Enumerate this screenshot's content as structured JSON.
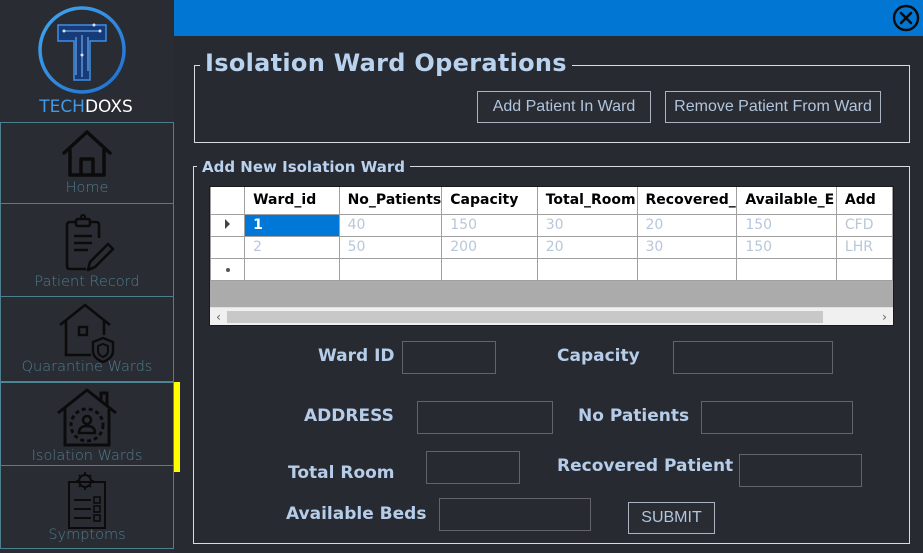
{
  "app": {
    "brand_part1": "TECH",
    "brand_part2": "DOXS",
    "close_icon": "circle-x-icon"
  },
  "sidebar": {
    "items": [
      {
        "label": "Home",
        "icon": "home-icon",
        "active": false
      },
      {
        "label": "Patient Record",
        "icon": "clipboard-pencil-icon",
        "active": false
      },
      {
        "label": "Quarantine Wards",
        "icon": "house-shield-icon",
        "active": false
      },
      {
        "label": "Isolation Wards",
        "icon": "house-person-icon",
        "active": true
      },
      {
        "label": "Symptoms",
        "icon": "virus-checklist-icon",
        "active": false
      }
    ],
    "active_indicator_color": "#ffff00"
  },
  "colors": {
    "topbar": "#0176d3",
    "background": "#282a32",
    "selection": "#0178d7",
    "label_text": "#b5cde9"
  },
  "operations": {
    "title": "Isolation Ward Operations",
    "add_patient_label": "Add Patient In Ward",
    "remove_patient_label": "Remove Patient From Ward"
  },
  "ward_form": {
    "title": "Add New Isolation Ward",
    "grid": {
      "columns": [
        "Ward_id",
        "No_Patients",
        "Capacity",
        "Total_Room",
        "Recovered_",
        "Available_E",
        "Add"
      ],
      "rows": [
        [
          "1",
          "40",
          "150",
          "30",
          "20",
          "150",
          "CFD"
        ],
        [
          "2",
          "50",
          "200",
          "20",
          "30",
          "150",
          "LHR"
        ]
      ],
      "selected_row": 0
    },
    "fields": {
      "ward_id": {
        "label": "Ward ID",
        "value": ""
      },
      "capacity": {
        "label": "Capacity",
        "value": ""
      },
      "address": {
        "label": "ADDRESS",
        "value": ""
      },
      "no_patients": {
        "label": "No Patients",
        "value": ""
      },
      "total_room": {
        "label": "Total Room",
        "value": ""
      },
      "recovered_patient": {
        "label": "Recovered Patient",
        "value": ""
      },
      "available_beds": {
        "label": "Available Beds",
        "value": ""
      }
    },
    "submit_label": "SUBMIT"
  }
}
